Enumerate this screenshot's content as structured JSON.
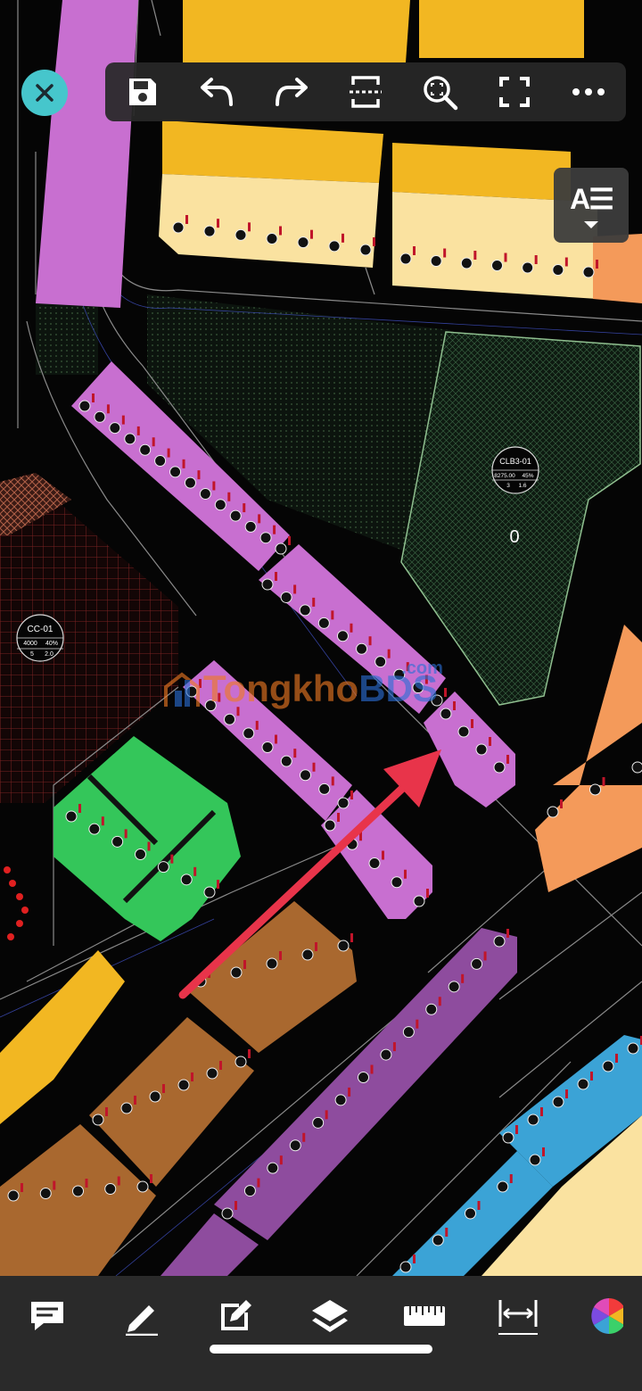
{
  "map": {
    "labels": {
      "cc01_code": "CC-01",
      "cc01_area": "4000",
      "cc01_density": "40%",
      "cc01_floors": "5",
      "cc01_far": "2.0",
      "club_code": "CLB3-01",
      "club_area": "8275.00",
      "club_density": "45%",
      "club_floors": "3",
      "club_far": "1.6",
      "zero_label": "0"
    }
  },
  "watermark": {
    "part1": "Tongkho",
    "part2": "BDS",
    "part3": ".com"
  },
  "toolbar": {
    "icons": [
      "save-icon",
      "undo-icon",
      "redo-icon",
      "section-icon",
      "zoom-fit-icon",
      "fullscreen-icon",
      "more-icon"
    ]
  },
  "text_style_button": {
    "label": "A☰"
  },
  "bottom_toolbar": {
    "icons": [
      "comment-icon",
      "pencil-icon",
      "edit-note-icon",
      "layers-icon",
      "ruler-icon",
      "dimension-icon",
      "color-wheel-icon"
    ]
  },
  "colors": {
    "accent": "#46c6cc",
    "magenta_lots": "#c86fd0",
    "arrow": "#e8344a",
    "green_lots": "#34c65a",
    "orange_lots": "#f49a5a",
    "brown_lots": "#a9682f",
    "purple_lots": "#8e4c9e",
    "blue_lots": "#3ba3d6",
    "yellow_lots": "#f2b722"
  }
}
